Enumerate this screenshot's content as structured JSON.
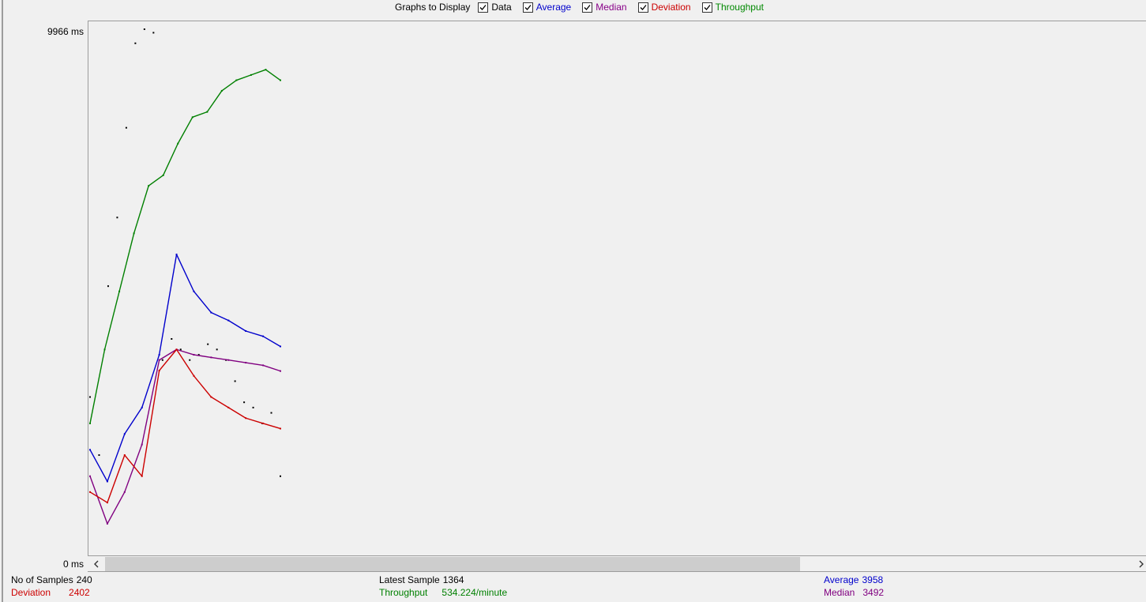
{
  "toolbar": {
    "label": "Graphs to Display",
    "options": [
      {
        "label": "Data",
        "checked": true,
        "color": "#000000"
      },
      {
        "label": "Average",
        "checked": true,
        "color": "#0000cc"
      },
      {
        "label": "Median",
        "checked": true,
        "color": "#880088"
      },
      {
        "label": "Deviation",
        "checked": true,
        "color": "#cc0000"
      },
      {
        "label": "Throughput",
        "checked": true,
        "color": "#008800"
      }
    ]
  },
  "axis": {
    "y_max_label": "9966  ms",
    "y_min_label": "0  ms"
  },
  "colors": {
    "data": "#000000",
    "average": "#0000cc",
    "median": "#800080",
    "deviation": "#cc0000",
    "throughput": "#008000"
  },
  "stats": {
    "samples_label": "No of Samples",
    "samples_value": "240",
    "deviation_label": "Deviation",
    "deviation_value": "2402",
    "latest_label": "Latest Sample",
    "latest_value": "1364",
    "throughput_label": "Throughput",
    "throughput_value": "534.224/minute",
    "average_label": "Average",
    "average_value": "3958",
    "median_label": "Median",
    "median_value": "3492"
  },
  "chart_data": {
    "type": "scatter",
    "ylim": [
      0,
      9966
    ],
    "y_unit": "ms",
    "series": [
      {
        "name": "Data",
        "values": [
          3000,
          1900,
          5100,
          6400,
          8100,
          9700,
          9966,
          9900,
          3700,
          4100,
          3900,
          3700,
          3800,
          4000,
          3900,
          3700,
          3300,
          2900,
          2800,
          2500,
          2700,
          1500
        ]
      },
      {
        "name": "Average",
        "values": [
          2000,
          1400,
          2300,
          2800,
          3800,
          5700,
          5000,
          4600,
          4450,
          4250,
          4150,
          3958
        ]
      },
      {
        "name": "Median",
        "values": [
          1500,
          600,
          1200,
          2100,
          3700,
          3900,
          3800,
          3750,
          3700,
          3650,
          3600,
          3492
        ]
      },
      {
        "name": "Deviation",
        "values": [
          1200,
          1000,
          1900,
          1500,
          3500,
          3900,
          3400,
          3000,
          2800,
          2600,
          2500,
          2402
        ]
      },
      {
        "name": "Throughput",
        "values": [
          2500,
          3900,
          5000,
          6100,
          7000,
          7200,
          7800,
          8300,
          8400,
          8800,
          9000,
          9100,
          9200,
          9000
        ]
      }
    ]
  }
}
